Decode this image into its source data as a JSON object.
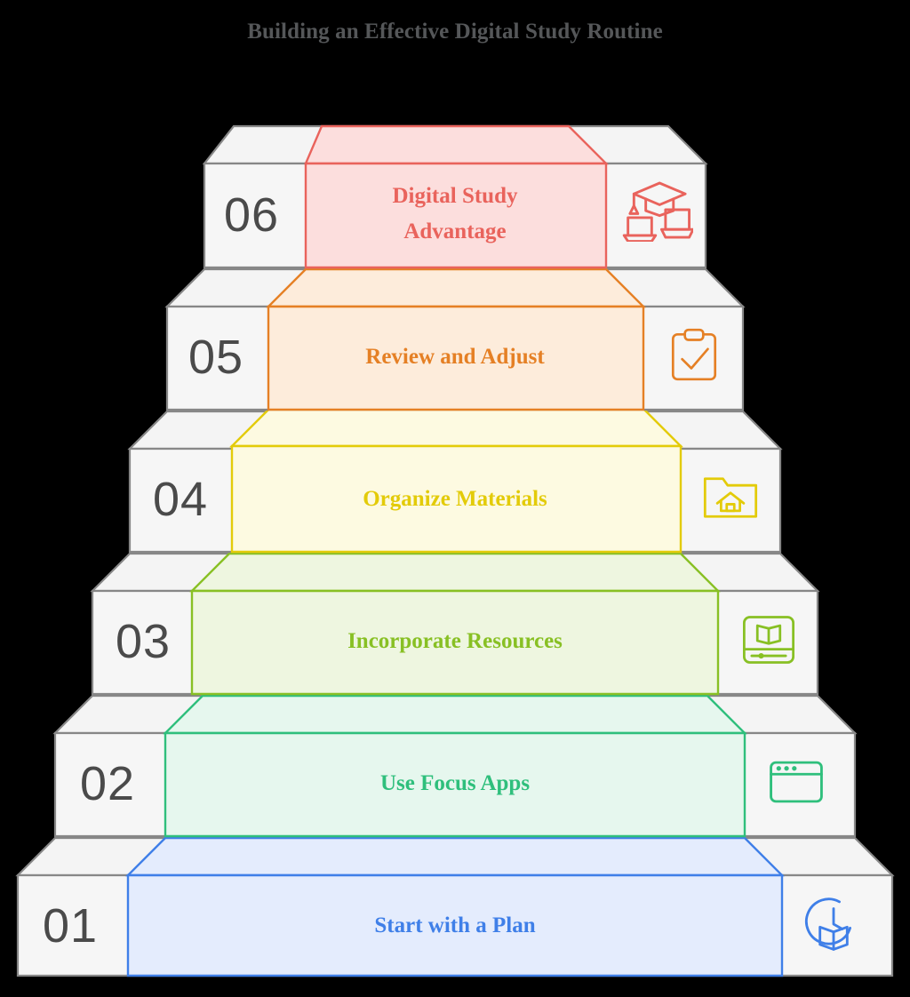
{
  "title": "Building an Effective Digital Study Routine",
  "diagram": {
    "type": "staircase-infographic",
    "step_count": 6,
    "orientation": "ascending-left-to-right",
    "background_color": "#000000",
    "tread_fill": "#f4f4f4",
    "tread_stroke": "#878787",
    "number_color": "#4a4a4a"
  },
  "steps": [
    {
      "number": "01",
      "label": "Start with a Plan",
      "icon": "clock-book-icon",
      "accent": "#3f7fe8",
      "fill": "#e4ecfd"
    },
    {
      "number": "02",
      "label": "Use Focus Apps",
      "icon": "browser-window-icon",
      "accent": "#2fbf7c",
      "fill": "#e6f7ee"
    },
    {
      "number": "03",
      "label": "Incorporate Resources",
      "icon": "open-book-screen-icon",
      "accent": "#88c024",
      "fill": "#eef6e0"
    },
    {
      "number": "04",
      "label": "Organize Materials",
      "icon": "folder-home-icon",
      "accent": "#e3cb09",
      "fill": "#fdfae1"
    },
    {
      "number": "05",
      "label": "Review and Adjust",
      "icon": "clipboard-check-icon",
      "accent": "#e58025",
      "fill": "#fdecdb"
    },
    {
      "number": "06",
      "label": "Digital Study Advantage",
      "label_line1": "Digital Study",
      "label_line2": "Advantage",
      "icon": "graduation-cap-laptops-icon",
      "accent": "#e9635c",
      "fill": "#fcdedd"
    }
  ]
}
